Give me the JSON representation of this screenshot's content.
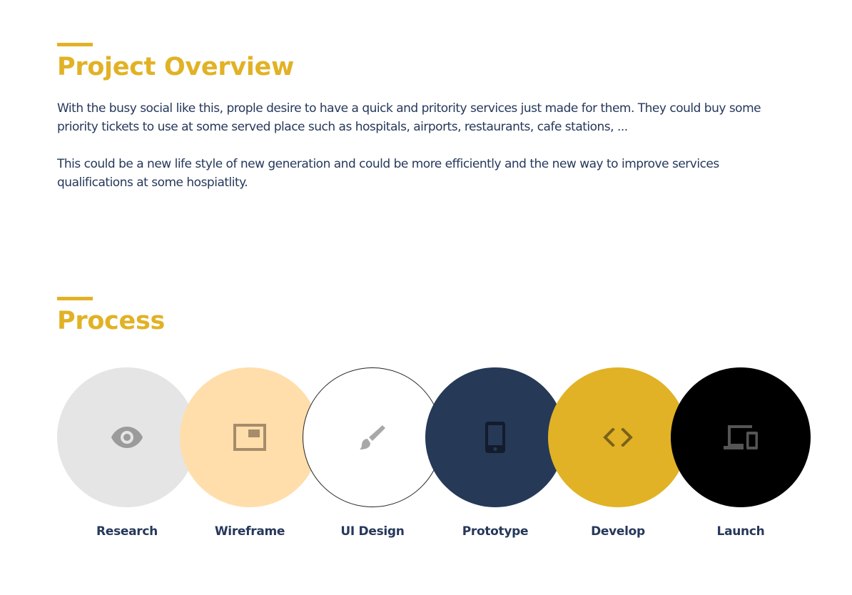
{
  "overview": {
    "title": "Project Overview",
    "paragraphs": [
      "With the busy social like this, prople desire to have a quick and pritority services just made for them. They could buy some priority tickets to use at some served place such as hospitals, airports, restaurants, cafe stations, ...",
      "This could be a new life style of new generation and could be more efficiently and the new way to improve services qualifications at some hospiatlity."
    ]
  },
  "process": {
    "title": "Process",
    "steps": [
      {
        "label": "Research",
        "icon": "eye-icon",
        "circle_color": "#e5e5e5",
        "icon_color": "#9b9b9b"
      },
      {
        "label": "Wireframe",
        "icon": "wireframe-icon",
        "circle_color": "#ffdeab",
        "icon_color": "#a68c6a"
      },
      {
        "label": "UI Design",
        "icon": "brush-icon",
        "circle_color": "#ffffff",
        "icon_color": "#a8a8a8"
      },
      {
        "label": "Prototype",
        "icon": "phone-icon",
        "circle_color": "#263957",
        "icon_color": "#121c2c"
      },
      {
        "label": "Develop",
        "icon": "code-icon",
        "circle_color": "#e1b225",
        "icon_color": "#7b6119"
      },
      {
        "label": "Launch",
        "icon": "devices-icon",
        "circle_color": "#000000",
        "icon_color": "#555555"
      }
    ]
  },
  "colors": {
    "accent": "#e1b225",
    "text": "#26385a"
  }
}
